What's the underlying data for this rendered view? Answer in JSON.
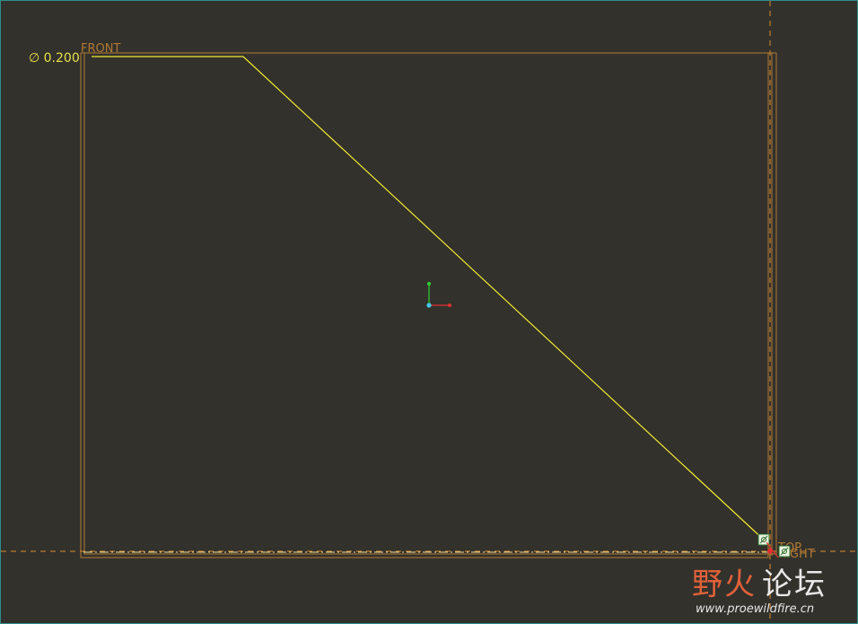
{
  "viewport": {
    "background": "#33312c",
    "frame_color": "#2f8c8c"
  },
  "sketch": {
    "dimension_text": "∅ 0.200",
    "datum_front_label": "FRONT",
    "datum_top_label": "TOP",
    "datum_right_label": "RIGHT",
    "colors": {
      "datum": "#b07a35",
      "sketch_line": "#f0e832",
      "coord_x": "#e03030",
      "coord_y": "#30d030",
      "coord_origin": "#40c8e8"
    },
    "constraint_icon": "coincident-constraint-icon"
  },
  "watermark": {
    "title_part1": "野火",
    "title_part2": "论坛",
    "url": "www.proewildfire.cn"
  }
}
